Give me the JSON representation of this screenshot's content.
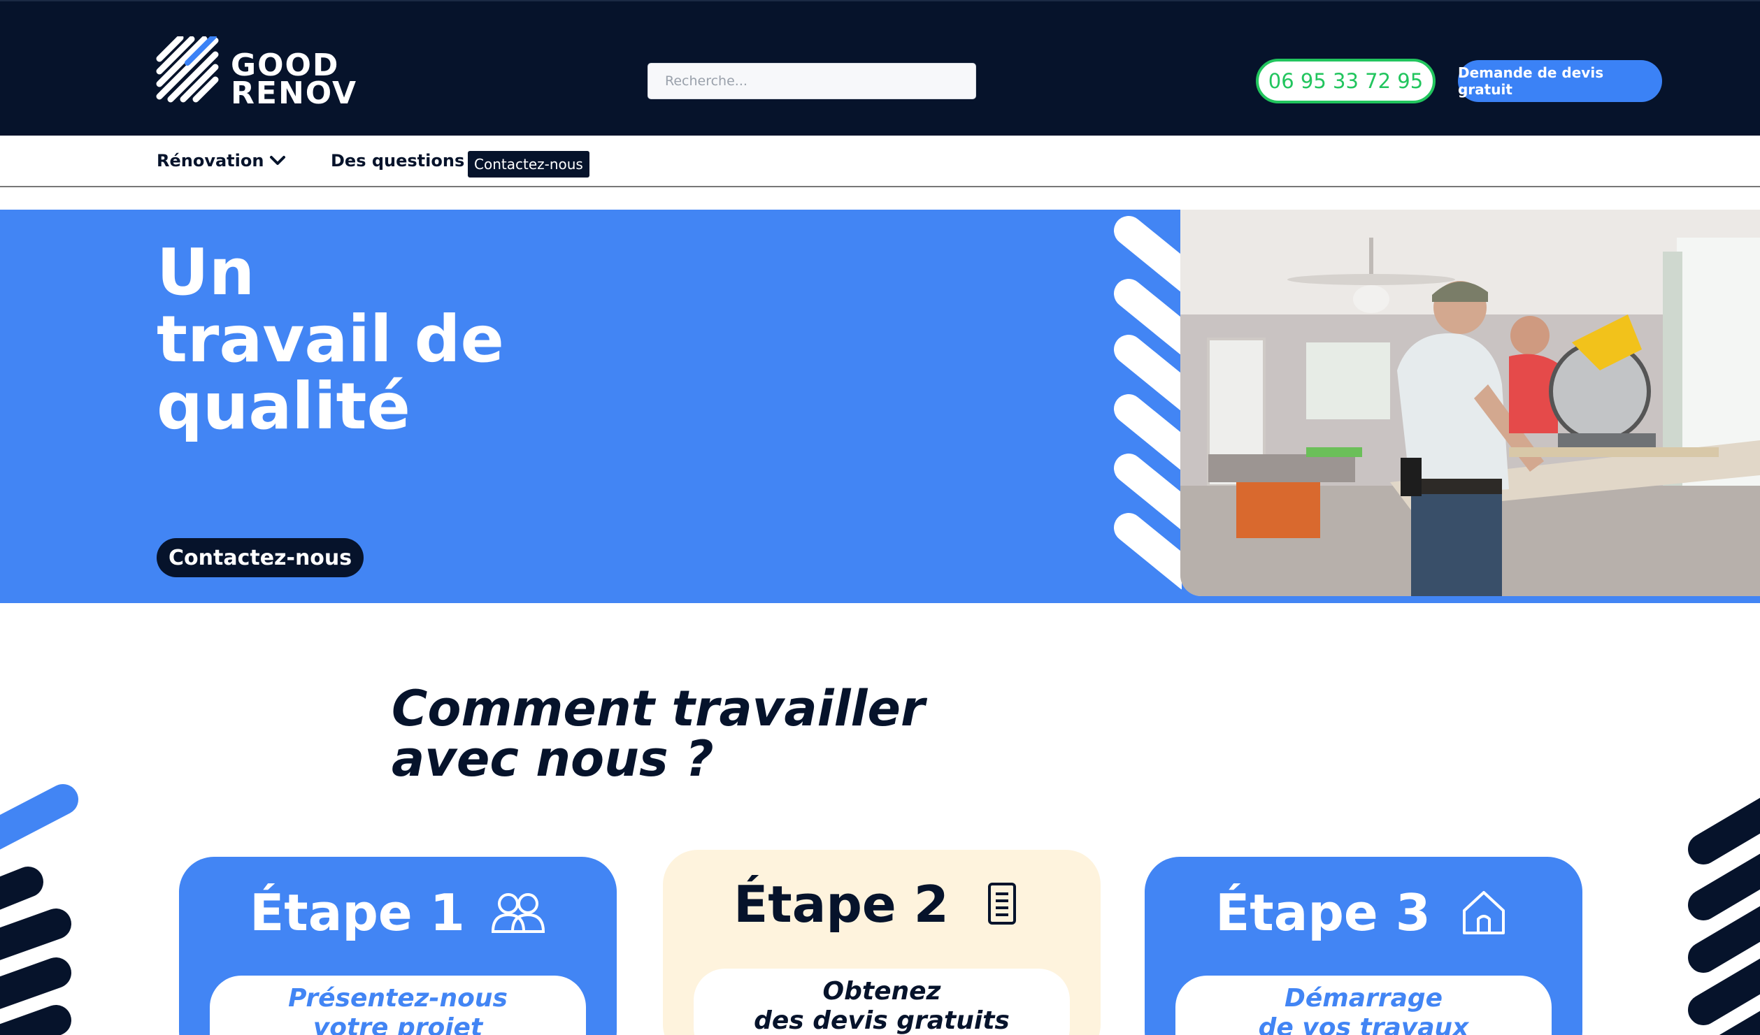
{
  "header": {
    "logo_line1": "GOOD",
    "logo_line2": "RENOV",
    "search_placeholder": "Recherche...",
    "phone": "06 95 33 72 95",
    "quote_button": "Demande de devis gratuit"
  },
  "nav": {
    "renovation": "Rénovation",
    "questions": "Des questions ?",
    "contact": "Contactez-nous"
  },
  "hero": {
    "title": "Un travail de qualité",
    "cta": "Contactez-nous"
  },
  "how": {
    "title_line1": "Comment travailler",
    "title_line2": "avec nous ?",
    "steps": [
      {
        "title": "Étape 1",
        "icon": "users-icon",
        "text_line1": "Présentez-nous",
        "text_line2": "votre projet"
      },
      {
        "title": "Étape 2",
        "icon": "document-icon",
        "text_line1": "Obtenez",
        "text_line2": "des devis gratuits"
      },
      {
        "title": "Étape 3",
        "icon": "house-icon",
        "text_line1": "Démarrage",
        "text_line2": "de vos travaux"
      }
    ]
  },
  "colors": {
    "navy": "#06132b",
    "blue": "#4285f4",
    "green": "#22c55e",
    "cream": "#fef3dd"
  }
}
